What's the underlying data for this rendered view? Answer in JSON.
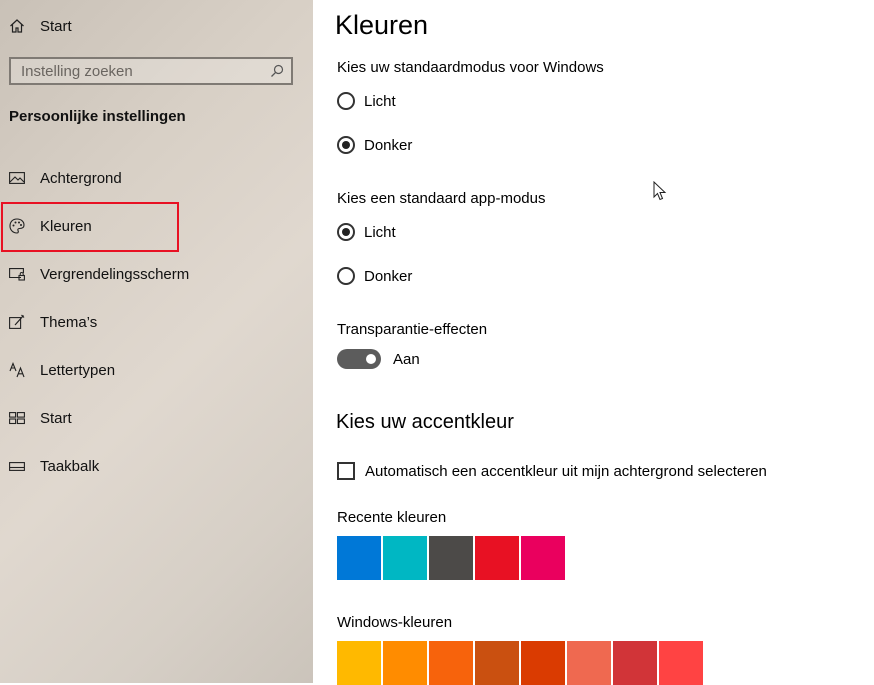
{
  "sidebar": {
    "home_label": "Start",
    "search_placeholder": "Instelling zoeken",
    "section_title": "Persoonlijke instellingen",
    "items": [
      {
        "label": "Achtergrond",
        "icon": "picture-icon"
      },
      {
        "label": "Kleuren",
        "icon": "palette-icon",
        "selected": true
      },
      {
        "label": "Vergrendelingsscherm",
        "icon": "lock-screen-icon"
      },
      {
        "label": "Thema’s",
        "icon": "themes-icon"
      },
      {
        "label": "Lettertypen",
        "icon": "font-icon"
      },
      {
        "label": "Start",
        "icon": "start-icon"
      },
      {
        "label": "Taakbalk",
        "icon": "taskbar-icon"
      }
    ]
  },
  "main": {
    "title": "Kleuren",
    "windows_mode": {
      "label": "Kies uw standaardmodus voor Windows",
      "options": [
        "Licht",
        "Donker"
      ],
      "selected": "Donker"
    },
    "app_mode": {
      "label": "Kies een standaard app-modus",
      "options": [
        "Licht",
        "Donker"
      ],
      "selected": "Licht"
    },
    "transparency": {
      "label": "Transparantie-effecten",
      "state_label": "Aan",
      "on": true
    },
    "accent_heading": "Kies uw accentkleur",
    "auto_accent_label": "Automatisch een accentkleur uit mijn achtergrond selecteren",
    "recent_label": "Recente kleuren",
    "recent_colors": [
      "#0078d7",
      "#00b7c3",
      "#4c4a48",
      "#e81123",
      "#ea005e"
    ],
    "windows_label": "Windows-kleuren",
    "windows_colors": [
      "#ffb900",
      "#ff8c00",
      "#f7630c",
      "#ca5010",
      "#da3b01",
      "#ef6950",
      "#d13438",
      "#ff4343"
    ]
  }
}
